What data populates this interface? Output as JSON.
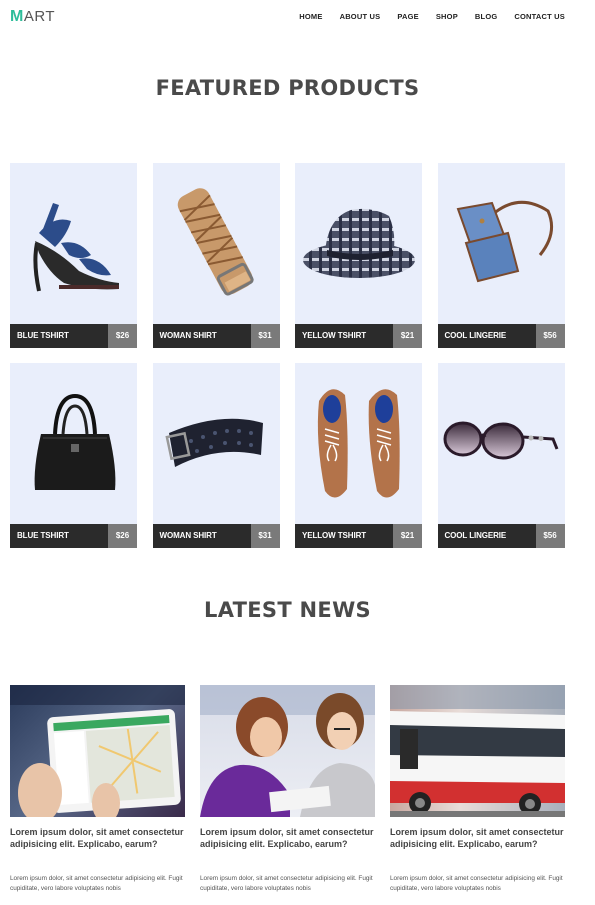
{
  "header": {
    "logo_initial": "M",
    "logo_rest": "ART",
    "nav": [
      "HOME",
      "ABOUT US",
      "PAGE",
      "SHOP",
      "BLOG",
      "CONTACT US"
    ]
  },
  "featured": {
    "title": "FEATURED PRODUCTS",
    "products": [
      {
        "name": "BLUE TSHIRT",
        "price": "$26",
        "image": "blue-heel-sandal"
      },
      {
        "name": "WOMAN SHIRT",
        "price": "$31",
        "image": "braided-leather-belt"
      },
      {
        "name": "YELLOW TSHIRT",
        "price": "$21",
        "image": "plaid-fedora-hat"
      },
      {
        "name": "COOL LINGERIE",
        "price": "$56",
        "image": "blue-shoulder-bag"
      },
      {
        "name": "BLUE TSHIRT",
        "price": "$26",
        "image": "black-handbag"
      },
      {
        "name": "WOMAN SHIRT",
        "price": "$31",
        "image": "black-perforated-belt"
      },
      {
        "name": "YELLOW TSHIRT",
        "price": "$21",
        "image": "brown-oxford-shoes"
      },
      {
        "name": "COOL LINGERIE",
        "price": "$56",
        "image": "sunglasses"
      }
    ]
  },
  "news": {
    "title": "LATEST NEWS",
    "items": [
      {
        "image": "tablet-map-photo",
        "headline": "Lorem ipsum dolor, sit amet consectetur adipisicing elit. Explicabo, earum?",
        "excerpt": "Lorem ipsum dolor, sit amet consectetur adipisicing elit. Fugit cupiditate, vero labore voluptates nobis"
      },
      {
        "image": "two-women-reading-photo",
        "headline": "Lorem ipsum dolor, sit amet consectetur adipisicing elit. Explicabo, earum?",
        "excerpt": "Lorem ipsum dolor, sit amet consectetur adipisicing elit. Fugit cupiditate, vero labore voluptates nobis"
      },
      {
        "image": "city-bus-photo",
        "headline": "Lorem ipsum dolor, sit amet consectetur adipisicing elit. Explicabo, earum?",
        "excerpt": "Lorem ipsum dolor, sit amet consectetur adipisicing elit. Fugit cupiditate, vero labore voluptates nobis"
      }
    ]
  },
  "colors": {
    "accent": "#2ebd9a",
    "card_bg": "#e9eefb",
    "bar_dark": "#2b2b2b",
    "price_bg": "#7a7a7a"
  }
}
